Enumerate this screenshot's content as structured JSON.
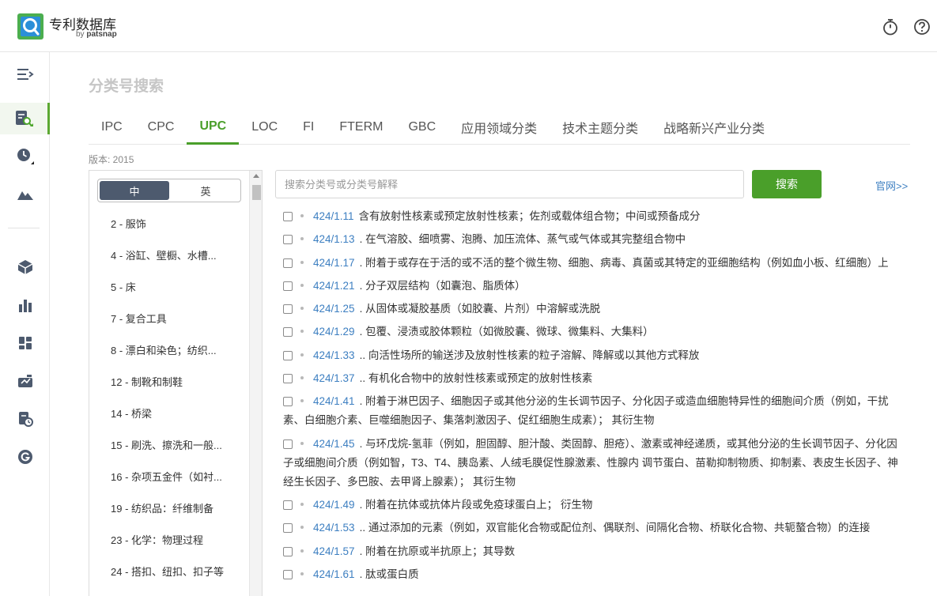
{
  "header": {
    "brand_name": "专利数据库",
    "brand_sub_prefix": "by ",
    "brand_sub_name": "patsnap",
    "icons": [
      "timer-icon",
      "help-icon"
    ]
  },
  "rail": {
    "icons": [
      "menu-collapse-icon",
      "patent-search-icon",
      "history-icon",
      "landscape-icon",
      "layers-icon",
      "bar-chart-icon",
      "dashboard-icon",
      "workspace-icon",
      "report-icon",
      "g-icon"
    ]
  },
  "page": {
    "title": "分类号搜索",
    "version": "版本: 2015"
  },
  "tabs": [
    {
      "label": "IPC"
    },
    {
      "label": "CPC"
    },
    {
      "label": "UPC"
    },
    {
      "label": "LOC"
    },
    {
      "label": "FI"
    },
    {
      "label": "FTERM"
    },
    {
      "label": "GBC"
    },
    {
      "label": "应用领域分类"
    },
    {
      "label": "技术主题分类"
    },
    {
      "label": "战略新兴产业分类"
    }
  ],
  "lang": {
    "zh": "中",
    "en": "英"
  },
  "classes": [
    {
      "label": "2 - 服饰"
    },
    {
      "label": "4 - 浴缸、壁橱、水槽..."
    },
    {
      "label": "5 - 床"
    },
    {
      "label": "7 - 复合工具"
    },
    {
      "label": "8 - 漂白和染色；纺织..."
    },
    {
      "label": "12 - 制靴和制鞋"
    },
    {
      "label": "14 - 桥梁"
    },
    {
      "label": "15 - 刷洗、擦洗和一般..."
    },
    {
      "label": "16 - 杂项五金件（如衬..."
    },
    {
      "label": "19 - 纺织品：纤维制备"
    },
    {
      "label": "23 - 化学：物理过程"
    },
    {
      "label": "24 - 搭扣、纽扣、扣子等"
    }
  ],
  "search": {
    "placeholder": "搜索分类号或分类号解释",
    "button": "搜索",
    "official_link": "官网>>"
  },
  "results": [
    {
      "code": "424/1.11",
      "text": "含有放射性核素或预定放射性核素；佐剂或载体组合物；中间或预备成分"
    },
    {
      "code": "424/1.13",
      "text": ". 在气溶胶、细喷雾、泡腾、加压流体、蒸气或气体或其完整组合物中"
    },
    {
      "code": "424/1.17",
      "text": ". 附着于或存在于活的或不活的整个微生物、细胞、病毒、真菌或其特定的亚细胞结构（例如血小板、红细胞）上"
    },
    {
      "code": "424/1.21",
      "text": ". 分子双层结构（如囊泡、脂质体）"
    },
    {
      "code": "424/1.25",
      "text": ". 从固体或凝胶基质（如胶囊、片剂）中溶解或洗脱"
    },
    {
      "code": "424/1.29",
      "text": ". 包覆、浸渍或胶体颗粒（如微胶囊、微球、微集料、大集料）"
    },
    {
      "code": "424/1.33",
      "text": ".. 向活性场所的输送涉及放射性核素的粒子溶解、降解或以其他方式释放"
    },
    {
      "code": "424/1.37",
      "text": ".. 有机化合物中的放射性核素或预定的放射性核素"
    },
    {
      "code": "424/1.41",
      "text": ". 附着于淋巴因子、细胞因子或其他分泌的生长调节因子、分化因子或造血细胞特异性的细胞间介质（例如，干扰素、白细胞介素、巨噬细胞因子、集落刺激因子、促红细胞生成素）； 其衍生物"
    },
    {
      "code": "424/1.45",
      "text": ". 与环戊烷-氢菲（例如，胆固醇、胆汁酸、类固醇、胆疮）、激素或神经递质，或其他分泌的生长调节因子、分化因子或细胞间介质（例如智，T3、T4、胰岛素、人绒毛膜促性腺激素、性腺内 调节蛋白、苗勒抑制物质、抑制素、表皮生长因子、神经生长因子、多巴胺、去甲肾上腺素）； 其衍生物"
    },
    {
      "code": "424/1.49",
      "text": ". 附着在抗体或抗体片段或免疫球蛋白上； 衍生物"
    },
    {
      "code": "424/1.53",
      "text": ".. 通过添加的元素（例如，双官能化合物或配位剂、偶联剂、间隔化合物、桥联化合物、共轭螯合物）的连接"
    },
    {
      "code": "424/1.57",
      "text": ". 附着在抗原或半抗原上；其导数"
    },
    {
      "code": "424/1.61",
      "text": ". 肽或蛋白质"
    }
  ]
}
